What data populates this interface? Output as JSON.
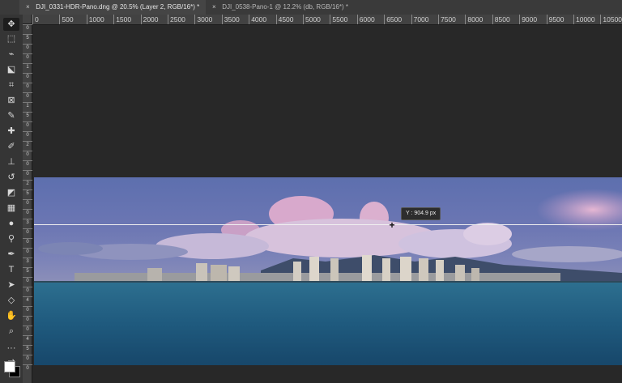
{
  "tabs": [
    {
      "label": "DJI_0331-HDR-Pano.dng @ 20.5% (Layer 2, RGB/16*) *",
      "close": "×",
      "active": true
    },
    {
      "label": "DJI_0538-Pano-1 @ 12.2% (db, RGB/16*) *",
      "close": "×",
      "active": false
    }
  ],
  "ruler": {
    "top_ticks": [
      "0",
      "500",
      "1000",
      "1500",
      "2000",
      "2500",
      "3000",
      "3500",
      "4000",
      "4500",
      "5000",
      "5500",
      "6000",
      "6500",
      "7000",
      "7500",
      "8000",
      "8500",
      "9000",
      "9500",
      "10000",
      "10500"
    ],
    "left_ticks": [
      "0",
      "5",
      "0",
      "0",
      "1",
      "0",
      "0",
      "0",
      "1",
      "5",
      "0",
      "0",
      "2",
      "0",
      "0",
      "0",
      "2",
      "5",
      "0",
      "0",
      "3",
      "0",
      "0",
      "0",
      "3",
      "5",
      "0",
      "0",
      "4",
      "0",
      "0",
      "0",
      "4",
      "5",
      "0",
      "0"
    ]
  },
  "tooltip": {
    "text": "Y : 904.9 px"
  },
  "tools": [
    {
      "name": "move-tool-icon",
      "glyph": "✥",
      "active": true
    },
    {
      "name": "marquee-tool-icon",
      "glyph": "⬚",
      "active": false
    },
    {
      "name": "lasso-tool-icon",
      "glyph": "⌁",
      "active": false
    },
    {
      "name": "object-select-tool-icon",
      "glyph": "⬕",
      "active": false
    },
    {
      "name": "crop-tool-icon",
      "glyph": "⌗",
      "active": false
    },
    {
      "name": "frame-tool-icon",
      "glyph": "⊠",
      "active": false
    },
    {
      "name": "eyedropper-tool-icon",
      "glyph": "✎",
      "active": false
    },
    {
      "name": "healing-brush-tool-icon",
      "glyph": "✚",
      "active": false
    },
    {
      "name": "brush-tool-icon",
      "glyph": "✐",
      "active": false
    },
    {
      "name": "stamp-tool-icon",
      "glyph": "⊥",
      "active": false
    },
    {
      "name": "history-brush-tool-icon",
      "glyph": "↺",
      "active": false
    },
    {
      "name": "eraser-tool-icon",
      "glyph": "◩",
      "active": false
    },
    {
      "name": "gradient-tool-icon",
      "glyph": "▦",
      "active": false
    },
    {
      "name": "blur-tool-icon",
      "glyph": "●",
      "active": false
    },
    {
      "name": "dodge-tool-icon",
      "glyph": "⚲",
      "active": false
    },
    {
      "name": "pen-tool-icon",
      "glyph": "✒",
      "active": false
    },
    {
      "name": "type-tool-icon",
      "glyph": "T",
      "active": false
    },
    {
      "name": "path-select-tool-icon",
      "glyph": "➤",
      "active": false
    },
    {
      "name": "shape-tool-icon",
      "glyph": "◇",
      "active": false
    },
    {
      "name": "hand-tool-icon",
      "glyph": "✋",
      "active": false
    },
    {
      "name": "zoom-tool-icon",
      "glyph": "⌕",
      "active": false
    },
    {
      "name": "more-tools-icon",
      "glyph": "···",
      "active": false
    },
    {
      "name": "swap-colors-icon",
      "glyph": "⇄",
      "active": false
    }
  ]
}
